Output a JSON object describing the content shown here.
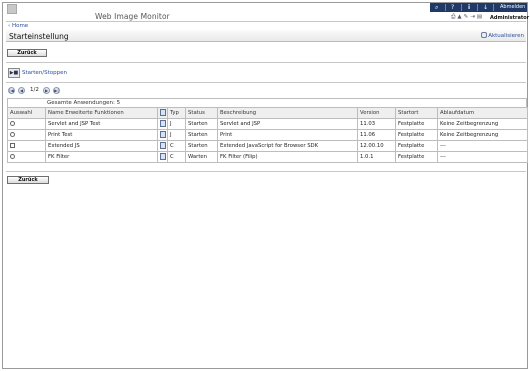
{
  "header": {
    "app_title": "Web Image Monitor",
    "logout_label": "Abmelden",
    "user_label": "Administrator",
    "home_link": "Home",
    "toolbar_icons": [
      "search-icon",
      "help-icon",
      "info-icon",
      "arrow-down-icon"
    ],
    "sub_icons": [
      "printer-icon",
      "warning-icon",
      "edit-icon",
      "scan-icon",
      "document-icon"
    ]
  },
  "page": {
    "title": "Starteinstellung",
    "refresh_label": "Aktualisieren",
    "back_label": "Zurück",
    "startstop_label": "Starten/Stoppen"
  },
  "pager": {
    "text": "1/2"
  },
  "table": {
    "summary": "Gesamte Anwendungen: 5",
    "columns": {
      "select": "Auswahl",
      "name": "Name Erweiterte Funktionen",
      "type": "Typ",
      "status": "Status",
      "description": "Beschreibung",
      "version": "Version",
      "location": "Startort",
      "expiry": "Ablaufdatum"
    },
    "rows": [
      {
        "name": "Servlet and JSP Test",
        "type": "J",
        "status": "Starten",
        "description": "Servlet and JSP",
        "version": "11.03",
        "location": "Festplatte",
        "expiry": "Keine Zeitbegrenzung",
        "control": "radio"
      },
      {
        "name": "Print Test",
        "type": "J",
        "status": "Starten",
        "description": "Print",
        "version": "11.06",
        "location": "Festplatte",
        "expiry": "Keine Zeitbegrenzung",
        "control": "radio"
      },
      {
        "name": "Extended JS",
        "type": "C",
        "status": "Starten",
        "description": "Extended JavaScript for Browser SDK",
        "version": "12.00.10",
        "location": "Festplatte",
        "expiry": "---",
        "control": "checkbox"
      },
      {
        "name": "FK Filter",
        "type": "C",
        "status": "Warten",
        "description": "FK Filter (Filip)",
        "version": "1.0.1",
        "location": "Festplatte",
        "expiry": "---",
        "control": "radio"
      }
    ]
  },
  "colors": {
    "toolbar": "#1f3a66",
    "link": "#2a4f9c",
    "border": "#bdbdbd"
  }
}
